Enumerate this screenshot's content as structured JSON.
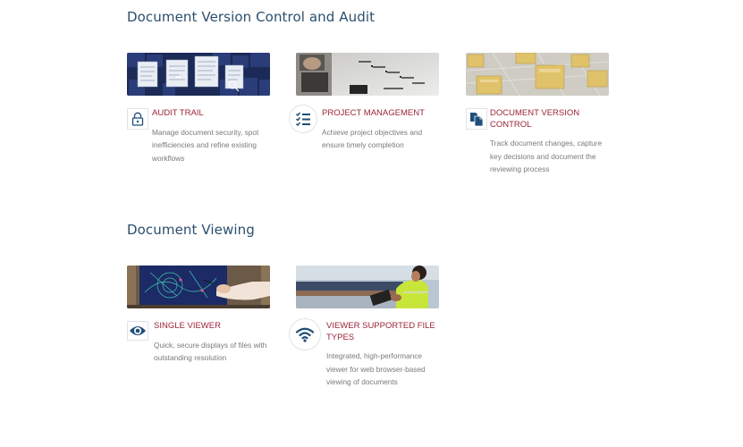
{
  "sections": [
    {
      "title": "Document Version Control and Audit",
      "cards": [
        {
          "title": "AUDIT TRAIL",
          "desc": "Manage document security, spot inefficiencies and refine existing workflows",
          "icon": "lock-icon",
          "image": "audit-documents-image"
        },
        {
          "title": "PROJECT MANAGEMENT",
          "desc": "Achieve project objectives and ensure timely completion",
          "icon": "checklist-icon",
          "image": "stairs-laptop-image"
        },
        {
          "title": "DOCUMENT VERSION CONTROL",
          "desc": "Track document changes, capture key decisions and document the reviewing process",
          "icon": "documents-copy-icon",
          "image": "folders-image"
        }
      ]
    },
    {
      "title": "Document Viewing",
      "cards": [
        {
          "title": "SINGLE VIEWER",
          "desc": "Quick, secure displays of files with outstanding resolution",
          "icon": "eye-icon",
          "image": "tablet-viewer-image"
        },
        {
          "title": "VIEWER SUPPORTED FILE TYPES",
          "desc": "Integrated, high-performance viewer for web browser-based viewing of documents",
          "icon": "wifi-icon",
          "image": "worker-tablet-image"
        }
      ]
    }
  ],
  "colors": {
    "heading": "#2c4e6c",
    "card_title": "#9b2436",
    "text": "#7a7a7a",
    "icon": "#1f4e79"
  }
}
